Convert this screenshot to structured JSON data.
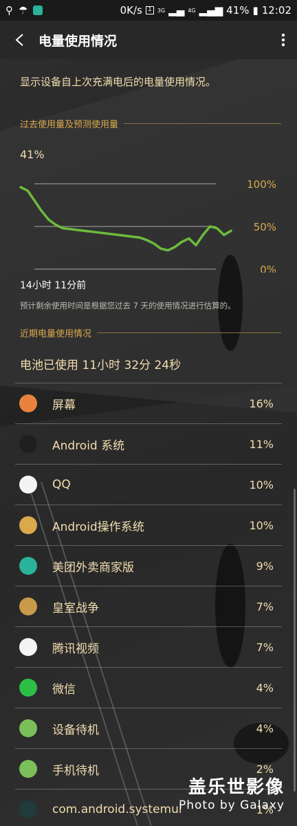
{
  "status_bar": {
    "net_speed": "0K/s",
    "sim": "1",
    "signal1": "3G",
    "signal2": "4G",
    "battery": "41%",
    "time": "12:02"
  },
  "header": {
    "title": "电量使用情况"
  },
  "main": {
    "description": "显示设备自上次充满电后的电量使用情况。",
    "section_past": "过去使用量及预测使用量",
    "current_percent": "41%",
    "chart_label_100": "100%",
    "chart_label_50": "50%",
    "chart_label_0": "0%",
    "elapsed": "14小时 11分前",
    "note": "预计剩余使用时间是根据您过去 7 天的使用情况进行估算的。",
    "section_recent": "近期电量使用情况",
    "battery_used": "电池已使用 11小时 32分 24秒"
  },
  "chart_data": {
    "type": "line",
    "ylim": [
      0,
      100
    ],
    "y_ticks": [
      "100%",
      "50%",
      "0%"
    ],
    "series": [
      {
        "values": [
          96,
          92,
          80,
          68,
          58,
          52,
          48,
          47,
          46,
          45,
          44,
          43,
          42,
          41,
          40,
          39,
          38,
          37,
          34,
          30,
          24,
          22,
          26,
          32,
          36,
          28,
          40,
          50,
          48,
          40,
          45
        ]
      }
    ]
  },
  "apps": [
    {
      "name": "屏幕",
      "percent": "16%",
      "icon": "screen-icon",
      "color": "#e8823e"
    },
    {
      "name": "Android 系统",
      "percent": "11%",
      "icon": "android-system-icon",
      "color": "#1f1f1f"
    },
    {
      "name": "QQ",
      "percent": "10%",
      "icon": "qq-icon",
      "color": "#f4f4f4"
    },
    {
      "name": "Android操作系统",
      "percent": "10%",
      "icon": "android-icon",
      "color": "#d9a94c"
    },
    {
      "name": "美团外卖商家版",
      "percent": "9%",
      "icon": "meituan-icon",
      "color": "#2ab29a"
    },
    {
      "name": "皇室战争",
      "percent": "7%",
      "icon": "clash-royale-icon",
      "color": "#c99a4a"
    },
    {
      "name": "腾讯视频",
      "percent": "7%",
      "icon": "tencent-video-icon",
      "color": "#f4f4f4"
    },
    {
      "name": "微信",
      "percent": "4%",
      "icon": "wechat-icon",
      "color": "#2bbf46"
    },
    {
      "name": "设备待机",
      "percent": "4%",
      "icon": "power-icon",
      "color": "#7bbf5a"
    },
    {
      "name": "手机待机",
      "percent": "2%",
      "icon": "signal-icon",
      "color": "#7bbf5a"
    },
    {
      "name": "com.android.systemui",
      "percent": "1%",
      "icon": "systemui-icon",
      "color": "#1f3b3b"
    }
  ],
  "watermark": {
    "line1": "盖乐世影像",
    "line2": "Photo by Galaxy"
  }
}
